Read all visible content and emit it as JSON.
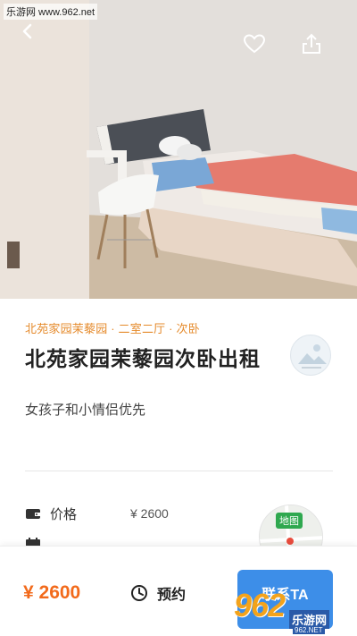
{
  "watermark": {
    "top_text": "乐游网 www.962.net",
    "bottom_num": "962",
    "bottom_label": "乐游网",
    "bottom_url": "962.NET"
  },
  "header": {
    "back_icon": "chevron-left-icon",
    "favorite_icon": "heart-icon",
    "share_icon": "share-icon"
  },
  "listing": {
    "breadcrumb": "北苑家园茉藜园 · 二室二厅 · 次卧",
    "title": "北苑家园茉藜园次卧出租",
    "subtitle": "女孩子和小情侣优先"
  },
  "info": {
    "rows": [
      {
        "icon": "wallet-icon",
        "label": "价格",
        "value": "¥ 2600"
      },
      {
        "icon": "calendar-icon",
        "label": "",
        "value": ""
      }
    ],
    "map_label": "地图"
  },
  "bottom_bar": {
    "price": "¥ 2600",
    "reserve_label": "预约",
    "contact_label": "联系TA"
  },
  "colors": {
    "accent_orange": "#f26a1b",
    "breadcrumb_orange": "#e58a2b",
    "primary_blue": "#3d8ee8"
  }
}
